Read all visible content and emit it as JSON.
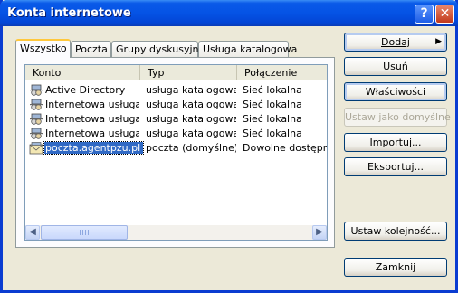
{
  "window": {
    "title": "Konta internetowe",
    "help_glyph": "?",
    "close_glyph": "✕"
  },
  "tabs": [
    {
      "label": "Wszystko",
      "active": true
    },
    {
      "label": "Poczta",
      "active": false
    },
    {
      "label": "Grupy dyskusyjne",
      "active": false
    },
    {
      "label": "Usługa katalogowa",
      "active": false
    }
  ],
  "list": {
    "columns": [
      "Konto",
      "Typ",
      "Połączenie"
    ],
    "rows": [
      {
        "name": "Active Directory",
        "type": "usługa katalogowa",
        "connection": "Sieć lokalna",
        "icon": "directory-account-icon",
        "selected": false
      },
      {
        "name": "Internetowa usługa ...",
        "type": "usługa katalogowa",
        "connection": "Sieć lokalna",
        "icon": "directory-account-icon",
        "selected": false
      },
      {
        "name": "Internetowa usługa ...",
        "type": "usługa katalogowa",
        "connection": "Sieć lokalna",
        "icon": "directory-account-icon",
        "selected": false
      },
      {
        "name": "Internetowa usługa ...",
        "type": "usługa katalogowa",
        "connection": "Sieć lokalna",
        "icon": "directory-account-icon",
        "selected": false
      },
      {
        "name": "poczta.agentpzu.pl",
        "type": "poczta (domyślne)",
        "connection": "Dowolne dostępne",
        "icon": "mail-account-icon",
        "selected": true
      }
    ]
  },
  "buttons": {
    "add": "Dodaj",
    "remove": "Usuń",
    "properties": "Właściwości",
    "set_default": "Ustaw jako domyślne",
    "import": "Importuj...",
    "export": "Eksportuj...",
    "set_order": "Ustaw kolejność...",
    "close": "Zamknij"
  },
  "colors": {
    "title_bar": "#0553e5",
    "selection": "#316ac5",
    "active_tab_accent": "#ffc83c"
  }
}
